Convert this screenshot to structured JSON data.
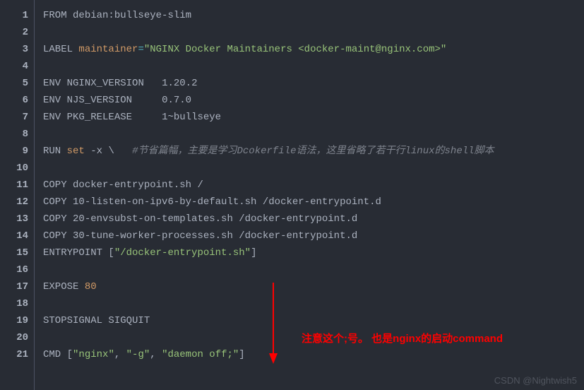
{
  "lines": {
    "l1": {
      "from": "FROM",
      "image": "debian:bullseye-slim"
    },
    "l3": {
      "label": "LABEL",
      "key": "maintainer",
      "eq": "=",
      "val": "\"NGINX Docker Maintainers <docker-maint@nginx.com>\""
    },
    "l5": {
      "env": "ENV",
      "var": "NGINX_VERSION",
      "val": "1.20.2"
    },
    "l6": {
      "env": "ENV",
      "var": "NJS_VERSION",
      "val": "0.7.0"
    },
    "l7": {
      "env": "ENV",
      "var": "PKG_RELEASE",
      "val": "1~bullseye"
    },
    "l9": {
      "run": "RUN",
      "set": "set",
      "flag": "-x",
      "cont": "\\",
      "cmt": "#节省篇幅，主要是学习Dcokerfile语法，这里省略了若干行linux的shell脚本"
    },
    "l11": {
      "copy": "COPY",
      "args": "docker-entrypoint.sh /"
    },
    "l12": {
      "copy": "COPY",
      "args": "10-listen-on-ipv6-by-default.sh /docker-entrypoint.d"
    },
    "l13": {
      "copy": "COPY",
      "args": "20-envsubst-on-templates.sh /docker-entrypoint.d"
    },
    "l14": {
      "copy": "COPY",
      "args": "30-tune-worker-processes.sh /docker-entrypoint.d"
    },
    "l15": {
      "ep": "ENTRYPOINT",
      "lb": "[",
      "val": "\"/docker-entrypoint.sh\"",
      "rb": "]"
    },
    "l17": {
      "expose": "EXPOSE",
      "port": "80"
    },
    "l19": {
      "stop": "STOPSIGNAL",
      "sig": "SIGQUIT"
    },
    "l21": {
      "cmd": "CMD",
      "lb": "[",
      "a1": "\"nginx\"",
      "c1": ", ",
      "a2": "\"-g\"",
      "c2": ", ",
      "a3": "\"daemon off;\"",
      "rb": "]"
    }
  },
  "lineNumbers": [
    "1",
    "2",
    "3",
    "4",
    "5",
    "6",
    "7",
    "8",
    "9",
    "10",
    "11",
    "12",
    "13",
    "14",
    "15",
    "16",
    "17",
    "18",
    "19",
    "20",
    "21"
  ],
  "annotation": "注意这个;号。  也是nginx的启动command",
  "watermark": "CSDN @Nightwish5"
}
